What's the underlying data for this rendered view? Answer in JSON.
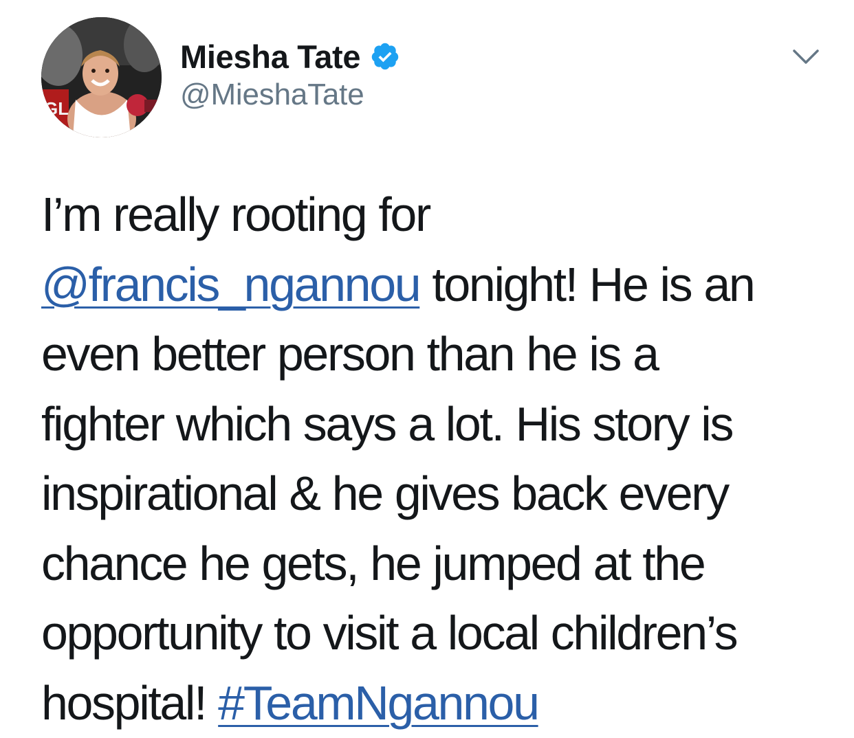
{
  "author": {
    "display_name": "Miesha Tate",
    "handle": "@MieshaTate",
    "verified": true
  },
  "icons": {
    "avatar": "profile-photo",
    "verified": "verified-badge-icon",
    "menu": "chevron-down-icon"
  },
  "colors": {
    "text": "#14171a",
    "secondary": "#657786",
    "link": "#2b5fa8",
    "verified": "#1da1f2"
  },
  "tweet": {
    "line1": "I’m really rooting for",
    "mention": "@francis_ngannou",
    "line2_rest": " tonight! He is an",
    "line3": "even better person than he is a",
    "line4": "fighter which says a lot. His story is",
    "line5": "inspirational & he gives back every",
    "line6": "chance he gets, he jumped at the",
    "line7": "opportunity to visit a local children’s",
    "line8_start": "hospital! ",
    "hashtag": "#TeamNgannou"
  }
}
